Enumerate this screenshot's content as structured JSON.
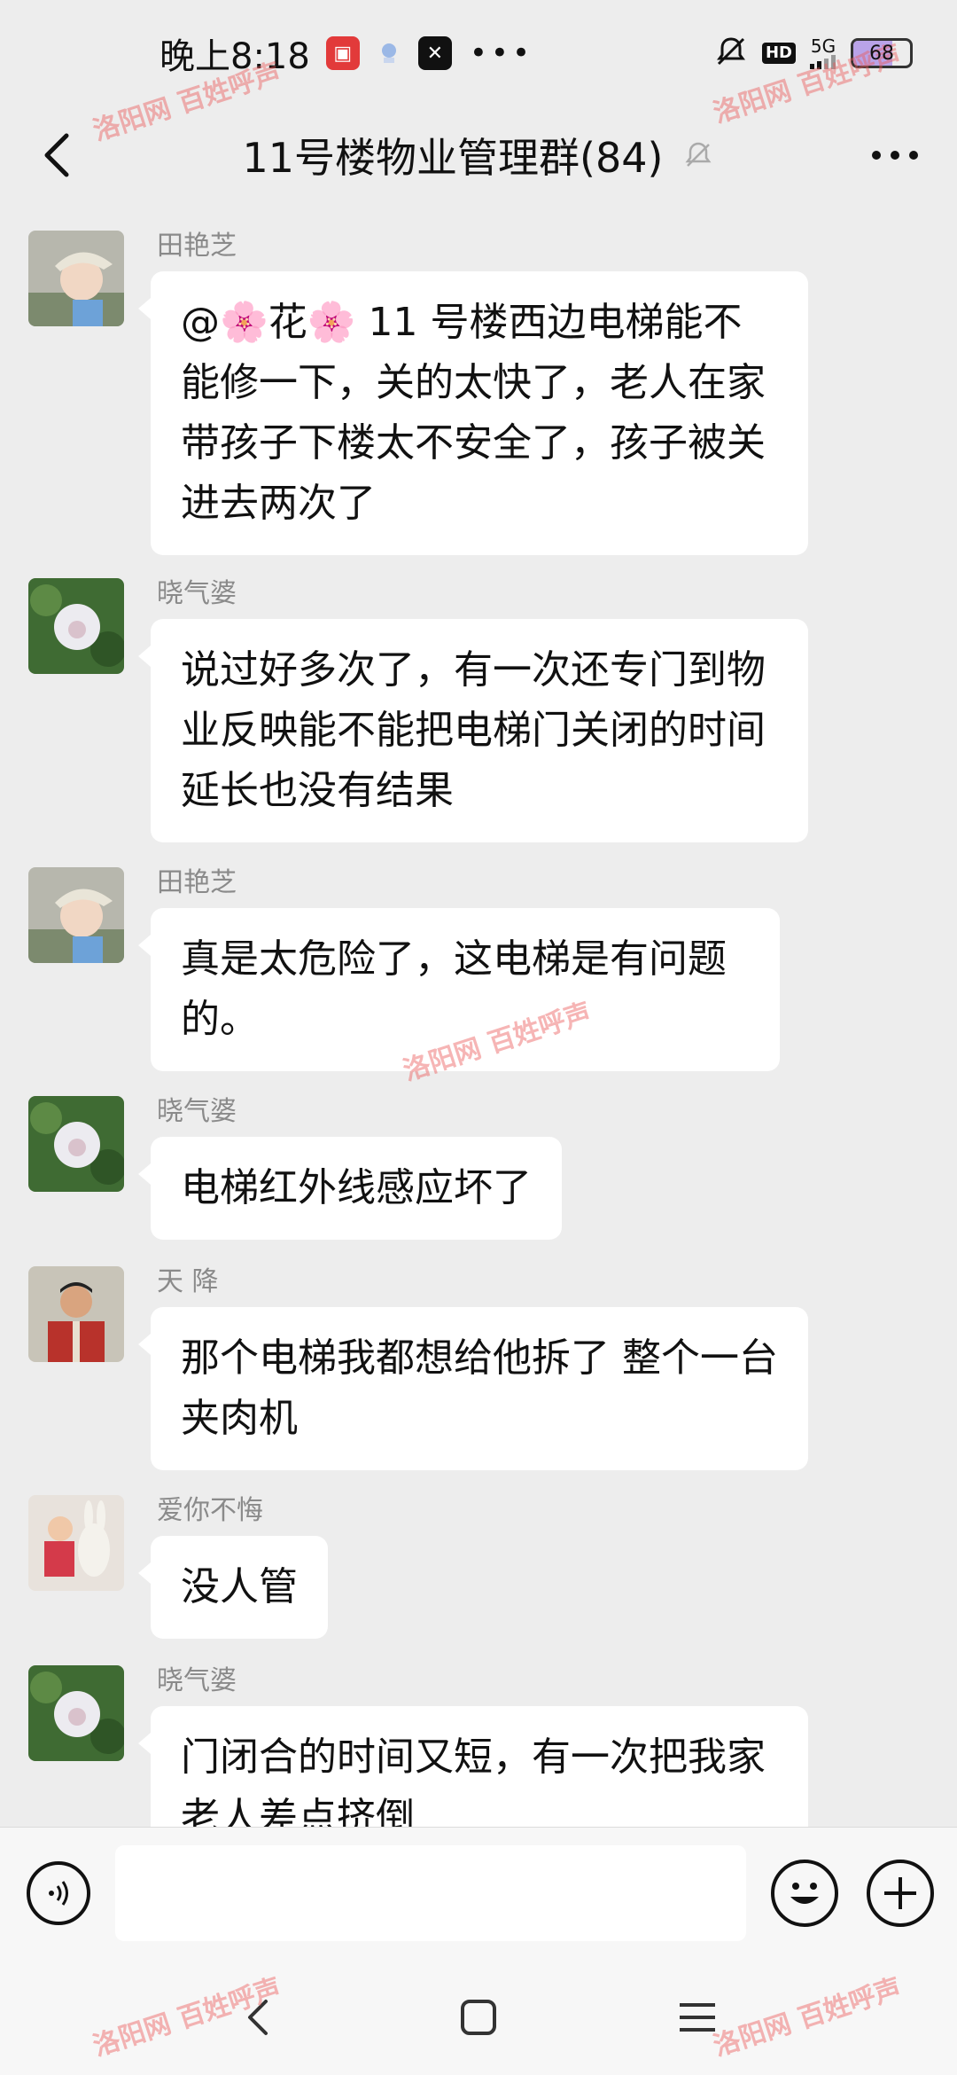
{
  "status_bar": {
    "time": "晚上8:18",
    "hd": "HD",
    "network": "5G",
    "battery": "68",
    "battery_level_percent": 68,
    "icons": [
      "app-red-icon",
      "app-notify-icon",
      "capcut-icon",
      "more-dots-icon",
      "mute-bell-icon",
      "signal-icon"
    ]
  },
  "header": {
    "title": "11号楼物业管理群(84)",
    "icons": [
      "back-arrow-icon",
      "muted-bell-icon",
      "more-icon"
    ]
  },
  "messages": [
    {
      "sender": "田艳芝",
      "text": "@🌸花🌸 11 号楼西边电梯能不能修一下，关的太快了，老人在家带孩子下楼太不安全了，孩子被关进去两次了",
      "avatar": "child-avatar"
    },
    {
      "sender": "晓气婆",
      "text": "说过好多次了，有一次还专门到物业反映能不能把电梯门关闭的时间延长也没有结果",
      "avatar": "flower-avatar"
    },
    {
      "sender": "田艳芝",
      "text": "真是太危险了，这电梯是有问题的。",
      "avatar": "child-avatar"
    },
    {
      "sender": "晓气婆",
      "text": "电梯红外线感应坏了",
      "avatar": "flower-avatar"
    },
    {
      "sender": "天 降",
      "text": "那个电梯我都想给他拆了 整个一台夹肉机",
      "avatar": "man-avatar"
    },
    {
      "sender": "爱你不悔",
      "text": "没人管",
      "avatar": "kid-toy-avatar"
    },
    {
      "sender": "晓气婆",
      "text": "门闭合的时间又短，有一次把我家老人差点挤倒",
      "avatar": "flower-avatar"
    }
  ],
  "input_bar": {
    "placeholder": "",
    "icons": [
      "voice-icon",
      "emoji-icon",
      "plus-icon"
    ]
  },
  "nav_bar": {
    "icons": [
      "nav-back-icon",
      "nav-home-icon",
      "nav-menu-icon"
    ]
  },
  "watermark": {
    "text": "洛阳网 百姓呼声"
  },
  "colors": {
    "background": "#ededed",
    "bubble": "#ffffff",
    "sender": "#8a8a8a",
    "watermark": "#eb5a5a"
  }
}
